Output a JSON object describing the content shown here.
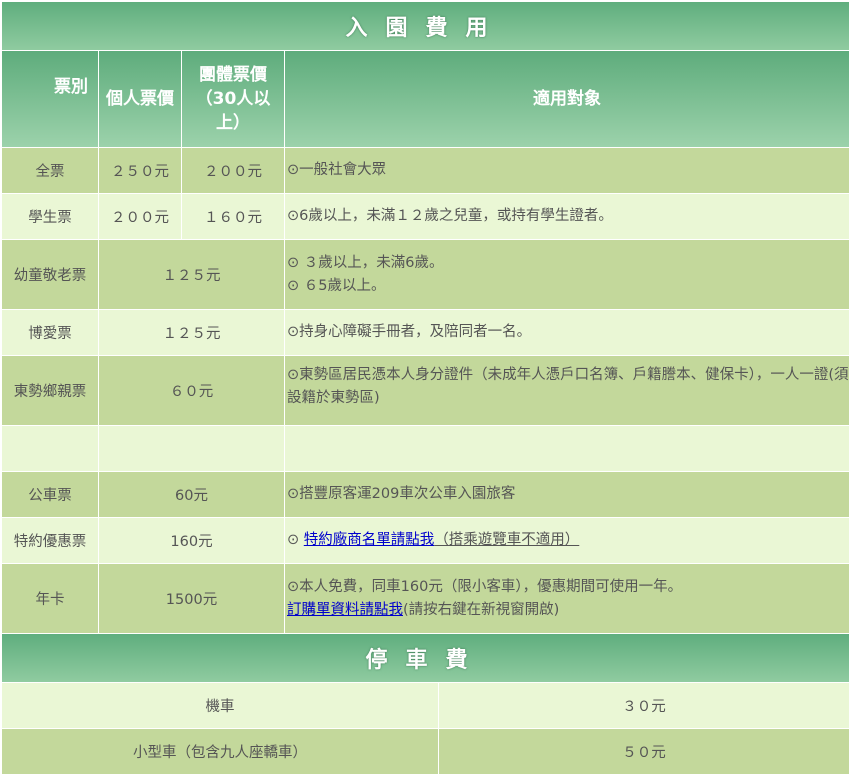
{
  "admission": {
    "title": "入園費用",
    "headers": {
      "type": "票別",
      "individual": "個人票價",
      "group": "團體票價（30人以上）",
      "target": "適用對象"
    },
    "rows": [
      {
        "type": "全票",
        "individual": "２５０元",
        "group": "２００元",
        "target": "⊙一般社會大眾"
      },
      {
        "type": "學生票",
        "individual": "２００元",
        "group": "１６０元",
        "target": "⊙6歲以上，未滿１２歲之兒童，或持有學生證者。"
      },
      {
        "type": "幼童敬老票",
        "price": "１２５元",
        "target_line1": "⊙ ３歲以上，未滿6歲。",
        "target_line2": "⊙ ６5歲以上。"
      },
      {
        "type": "博愛票",
        "price": "１２５元",
        "target": "⊙持身心障礙手冊者，及陪同者一名。"
      },
      {
        "type": "東勢鄉親票",
        "price": "６０元",
        "target": "⊙東勢區居民憑本人身分證件（未成年人憑戶口名簿、戶籍謄本、健保卡），一人一證(須設籍於東勢區)"
      },
      {
        "type": "公車票",
        "price": "60元",
        "target": "⊙搭豐原客運209車次公車入園旅客"
      },
      {
        "type": "特約優惠票",
        "price": "160元",
        "target_prefix": "⊙ ",
        "target_link": "特約廠商名單請點我",
        "target_suffix": "（搭乘遊覽車不適用）"
      },
      {
        "type": "年卡",
        "price": "1500元",
        "target_line1": "⊙本人免費，同車160元（限小客車），優惠期間可使用一年。",
        "target_link": "訂購單資料請點我",
        "target_suffix": "(請按右鍵在新視窗開啟)"
      }
    ]
  },
  "parking": {
    "title": "停車費",
    "rows": [
      {
        "vehicle": "機車",
        "fee": "３０元"
      },
      {
        "vehicle": "小型車（包含九人座轎車）",
        "fee": "５０元"
      }
    ]
  }
}
